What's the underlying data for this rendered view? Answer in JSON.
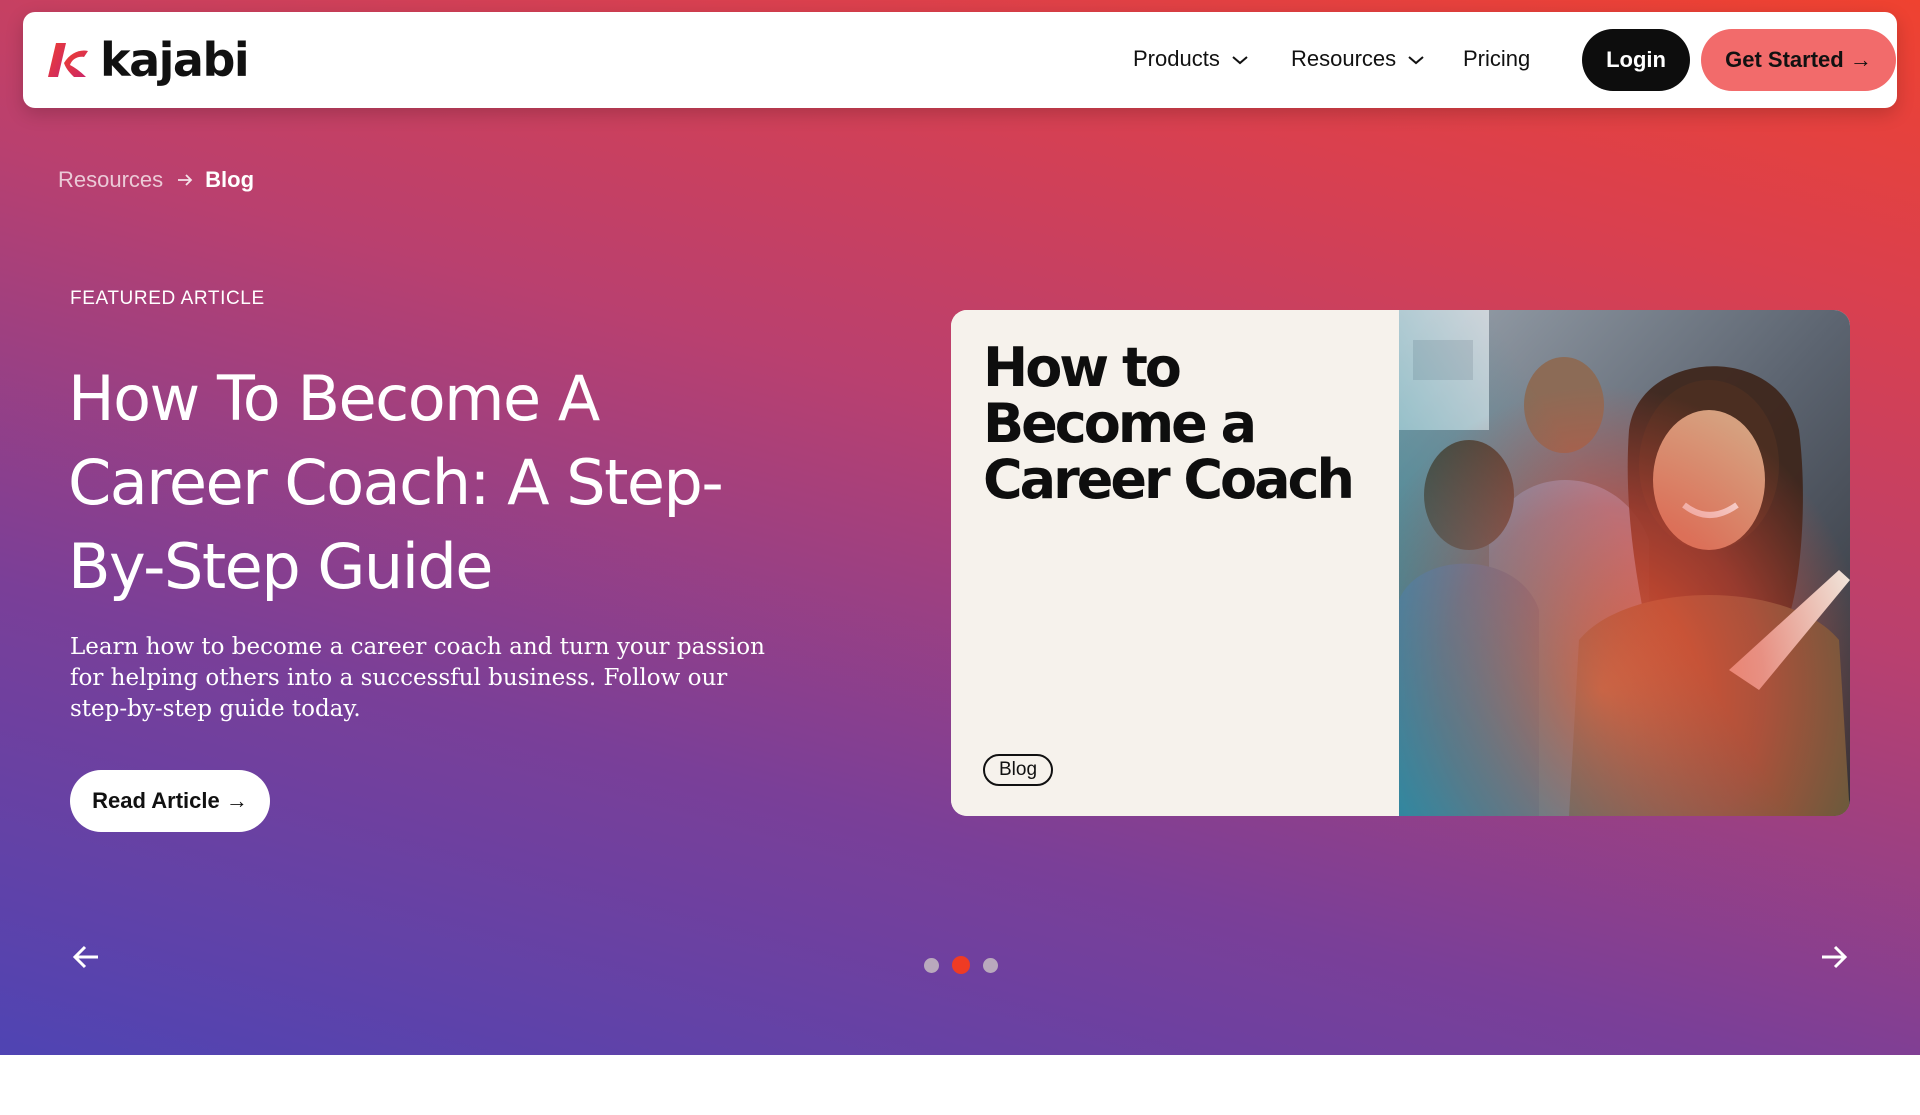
{
  "brand": {
    "name": "kajabi",
    "accent": "#ef4230",
    "cta_color": "#f26b6b"
  },
  "nav": {
    "products_label": "Products",
    "resources_label": "Resources",
    "pricing_label": "Pricing",
    "login_label": "Login",
    "get_started_label": "Get Started →"
  },
  "breadcrumb": {
    "items": [
      "Resources",
      "Blog"
    ]
  },
  "featured": {
    "eyebrow": "FEATURED ARTICLE",
    "title": "How To Become A Career Coach: A Step-By-Step Guide",
    "description": "Learn how to become a career coach and turn your passion for helping others into a successful business. Follow our step-by-step guide today.",
    "cta_label": "Read Article →"
  },
  "card": {
    "title": "How to Become a Career Coach",
    "tag": "Blog",
    "image": "photo of smiling woman writing on whiteboard with colleagues in background"
  },
  "carousel": {
    "slide_count": 3,
    "active_index": 1,
    "prev_icon": "arrow-left-icon",
    "next_icon": "arrow-right-icon"
  }
}
